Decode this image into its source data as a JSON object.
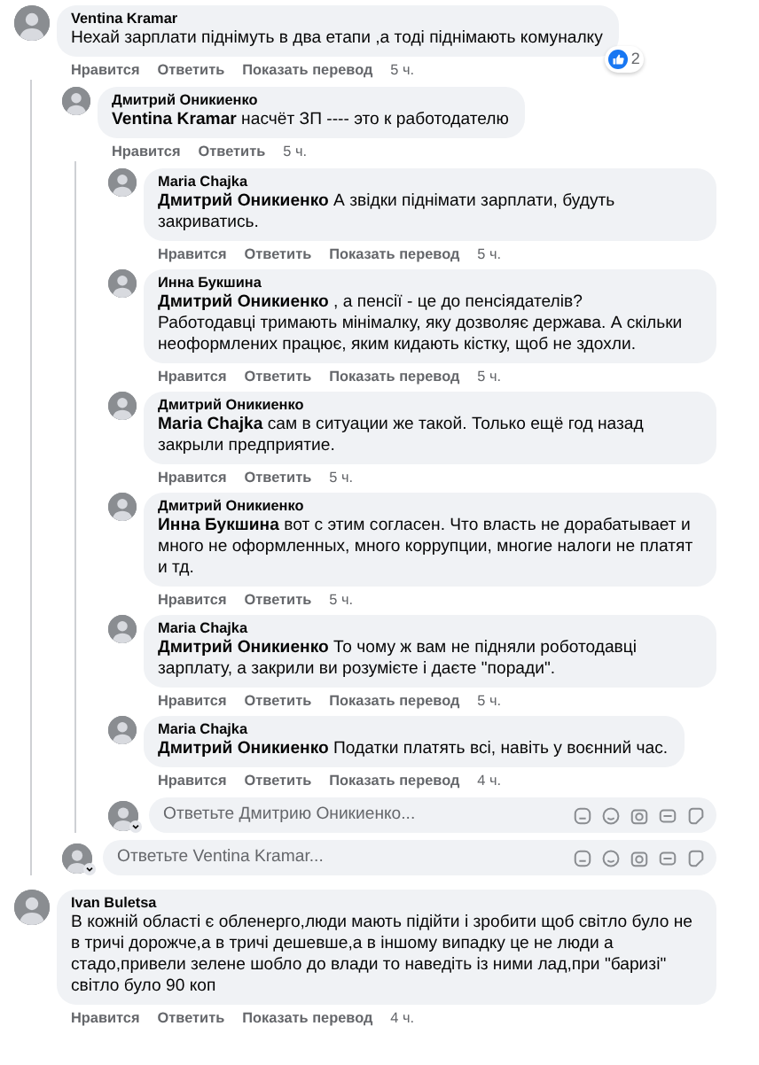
{
  "comments": [
    {
      "author": "Ventina Kramar",
      "text": "Нехай зарплати піднімуть в два етапи ,а тоді піднімають комуналку",
      "reactions": {
        "count": "2"
      },
      "actions": [
        {
          "kind": "link",
          "label": "Нравится"
        },
        {
          "kind": "link",
          "label": "Ответить"
        },
        {
          "kind": "link",
          "label": "Показать перевод"
        },
        {
          "kind": "time",
          "label": "5 ч."
        }
      ],
      "replies": [
        {
          "author": "Дмитрий Оникиенко",
          "text": "**Ventina Kramar** насчёт ЗП ---- это к работодателю",
          "actions": [
            {
              "kind": "link",
              "label": "Нравится"
            },
            {
              "kind": "link",
              "label": "Ответить"
            },
            {
              "kind": "time",
              "label": "5 ч."
            }
          ],
          "replies": [
            {
              "author": "Maria Chajka",
              "text": "**Дмитрий Оникиенко** А звідки піднімати зарплати, будуть закриватись.",
              "actions": [
                {
                  "kind": "link",
                  "label": "Нравится"
                },
                {
                  "kind": "link",
                  "label": "Ответить"
                },
                {
                  "kind": "link",
                  "label": "Показать перевод"
                },
                {
                  "kind": "time",
                  "label": "5 ч."
                }
              ]
            },
            {
              "author": "Инна Букшина",
              "text": "**Дмитрий Оникиенко** , а пенсії - це до пенсіядателів?\nРаботодавці тримають мінімалку, яку дозволяє держава. А скільки неоформлених працює, яким кидають кістку, щоб не здохли.",
              "actions": [
                {
                  "kind": "link",
                  "label": "Нравится"
                },
                {
                  "kind": "link",
                  "label": "Ответить"
                },
                {
                  "kind": "link",
                  "label": "Показать перевод"
                },
                {
                  "kind": "time",
                  "label": "5 ч."
                }
              ]
            },
            {
              "author": "Дмитрий Оникиенко",
              "text": "**Maria Chajka** сам в ситуации же такой. Только ещё год назад закрыли предприятие.",
              "actions": [
                {
                  "kind": "link",
                  "label": "Нравится"
                },
                {
                  "kind": "link",
                  "label": "Ответить"
                },
                {
                  "kind": "time",
                  "label": "5 ч."
                }
              ]
            },
            {
              "author": "Дмитрий Оникиенко",
              "text": "**Инна Букшина** вот с этим согласен. Что власть не дорабатывает и много не оформленных, много коррупции, многие налоги не платят и тд.",
              "actions": [
                {
                  "kind": "link",
                  "label": "Нравится"
                },
                {
                  "kind": "link",
                  "label": "Ответить"
                },
                {
                  "kind": "time",
                  "label": "5 ч."
                }
              ]
            },
            {
              "author": "Maria Chajka",
              "text": "**Дмитрий Оникиенко** То чому ж вам не підняли роботодавці зарплату, а закрили ви розумієте і даєте \"поради\".",
              "actions": [
                {
                  "kind": "link",
                  "label": "Нравится"
                },
                {
                  "kind": "link",
                  "label": "Ответить"
                },
                {
                  "kind": "link",
                  "label": "Показать перевод"
                },
                {
                  "kind": "time",
                  "label": "5 ч."
                }
              ]
            },
            {
              "author": "Maria Chajka",
              "text": "**Дмитрий Оникиенко** Податки платять всі, навіть у воєнний час.",
              "actions": [
                {
                  "kind": "link",
                  "label": "Нравится"
                },
                {
                  "kind": "link",
                  "label": "Ответить"
                },
                {
                  "kind": "link",
                  "label": "Показать перевод"
                },
                {
                  "kind": "time",
                  "label": "4 ч."
                }
              ]
            }
          ],
          "reply_field": {
            "placeholder": "Ответьте Дмитрию Оникиенко..."
          }
        }
      ],
      "reply_field": {
        "placeholder": "Ответьте Ventina Kramar..."
      }
    },
    {
      "author": "Ivan Buletsa",
      "text": "В кожній області є обленерго,люди мають підійти і зробити щоб світло було не в тричі дорожче,а в тричі дешевше,а в іншому випадку це не люди а стадо,привели зелене шобло до влади то наведіть із ними лад,при \"баризі\" світло було 90 коп",
      "actions": [
        {
          "kind": "link",
          "label": "Нравится"
        },
        {
          "kind": "link",
          "label": "Ответить"
        },
        {
          "kind": "link",
          "label": "Показать перевод"
        },
        {
          "kind": "time",
          "label": "4 ч."
        }
      ]
    }
  ]
}
